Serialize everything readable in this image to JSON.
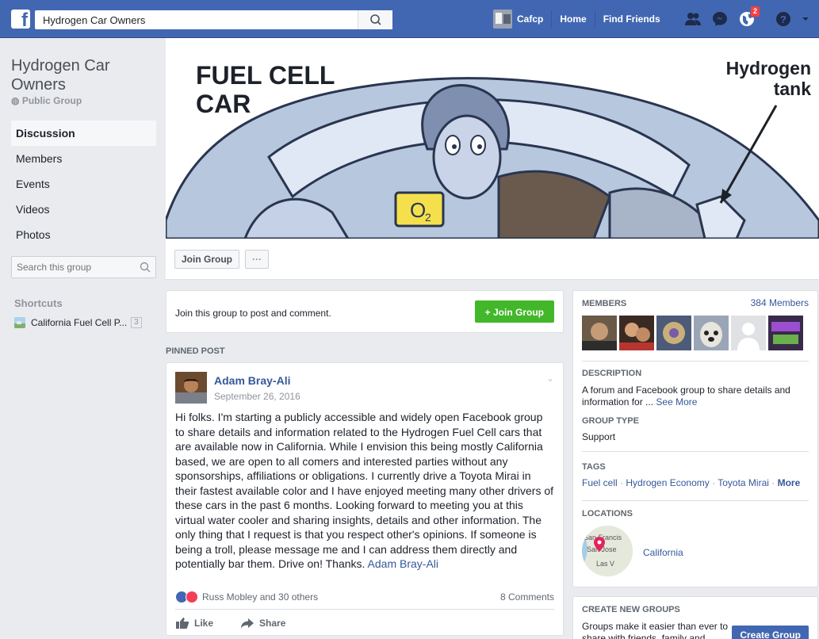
{
  "topbar": {
    "logo_letter": "f",
    "search_value": "Hydrogen Car Owners",
    "profile_name": "Cafcp",
    "home": "Home",
    "find_friends": "Find Friends",
    "notif_count": "2"
  },
  "group": {
    "name": "Hydrogen Car Owners",
    "privacy": "Public Group",
    "join_label": "Join Group",
    "more_label": "···",
    "join_prompt": "Join this group to post and comment.",
    "join_green_label": "+ Join Group"
  },
  "cover": {
    "text_left_1": "FUEL CELL",
    "text_left_2": "CAR",
    "text_right_1": "Hydrogen",
    "text_right_2": "tank",
    "o2_label": "O",
    "o2_sub": "2"
  },
  "leftnav": {
    "items": [
      "Discussion",
      "Members",
      "Events",
      "Videos",
      "Photos"
    ],
    "search_placeholder": "Search this group",
    "shortcuts_label": "Shortcuts",
    "shortcut_name": "California Fuel Cell P...",
    "shortcut_count": "3"
  },
  "post": {
    "pinned_label": "PINNED POST",
    "author": "Adam Bray-Ali",
    "date": "September 26, 2016",
    "body": "Hi folks. I'm starting a publicly accessible and widely open Facebook group to share details and information related to the Hydrogen Fuel Cell cars that are available now in California. While I envision this being mostly California based, we are open to all comers and interested parties without any sponsorships, affiliations or obligations. I currently drive a Toyota Mirai in their fastest available color and I have enjoyed meeting many other drivers of these cars in the past 6 months. Looking forward to meeting you at this virtual water cooler and sharing insights, details and other information. The only thing that I request is that you respect other's opinions. If someone is being a troll, please message me and I can address them directly and potentially bar them. Drive on! Thanks.",
    "body_tag": "Adam Bray-Ali",
    "reactions_text": "Russ Mobley and 30 others",
    "comments": "8 Comments",
    "like": "Like",
    "share": "Share"
  },
  "right": {
    "members_title": "MEMBERS",
    "members_count": "384 Members",
    "description_title": "DESCRIPTION",
    "description_text": "A forum and Facebook group to share details and information for ...",
    "see_more": "See More",
    "group_type_title": "GROUP TYPE",
    "group_type": "Support",
    "tags_title": "TAGS",
    "tags": [
      "Fuel cell",
      "Hydrogen Economy",
      "Toyota Mirai"
    ],
    "tags_more": "More",
    "locations_title": "LOCATIONS",
    "location": "California",
    "map_labels": [
      "San Francis",
      "San Jose",
      "Las V"
    ],
    "create_title": "CREATE NEW GROUPS",
    "create_text": "Groups make it easier than ever to share with friends, family and",
    "create_button": "Create Group"
  },
  "colors": {
    "brand": "#4267b2",
    "link": "#365899",
    "green": "#42b72a",
    "background": "#e9ebee"
  }
}
